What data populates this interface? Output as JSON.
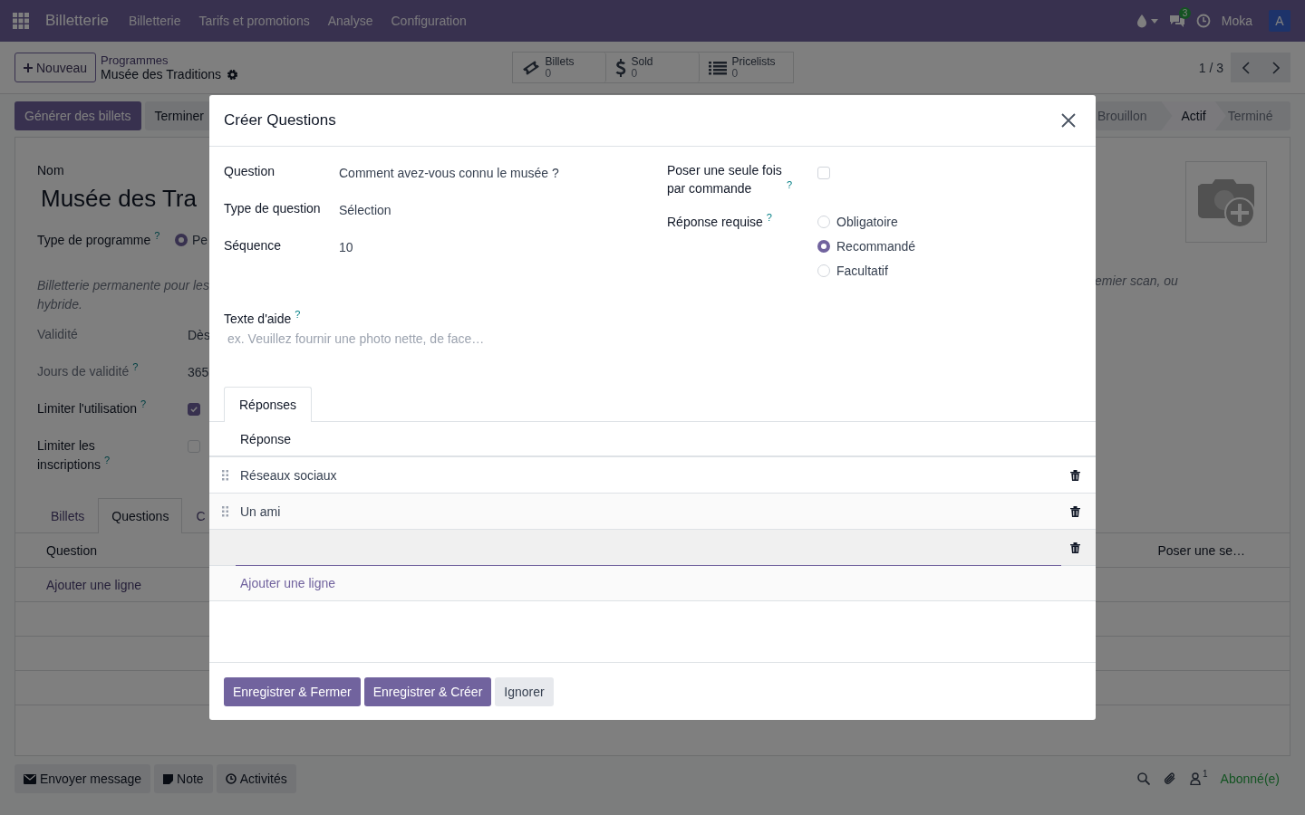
{
  "navbar": {
    "app_name": "Billetterie",
    "menu": [
      "Billetterie",
      "Tarifs et promotions",
      "Analyse",
      "Configuration"
    ],
    "chat_count": "3",
    "company": "Moka",
    "avatar": "A"
  },
  "control_panel": {
    "new_button": "Nouveau",
    "breadcrumb": "Programmes",
    "record_title": "Musée des Traditions",
    "smart_buttons": [
      {
        "kind": "ticket",
        "label": "Billets",
        "value": "0"
      },
      {
        "kind": "dollar",
        "label": "Sold",
        "value": "0"
      },
      {
        "kind": "list",
        "label": "Pricelists",
        "value": "0"
      }
    ],
    "pager": "1 / 3"
  },
  "status_bar": {
    "buttons": [
      {
        "label": "Générer des billets",
        "primary": true
      },
      {
        "label": "Terminer",
        "primary": false
      }
    ],
    "stages": [
      {
        "label": "Brouillon",
        "selected": false
      },
      {
        "label": "Actif",
        "selected": true
      },
      {
        "label": "Terminé",
        "selected": false
      }
    ]
  },
  "form": {
    "name_label": "Nom",
    "name_value": "Musée des Tra",
    "program_type": {
      "label": "Type de programme",
      "help": "?",
      "option": "Pe",
      "selected": true
    },
    "description_left": [
      "Billetterie permanente pour les",
      "hybride."
    ],
    "description_right": "emier scan, ou",
    "fields": [
      {
        "kind": "text",
        "label": "Validité",
        "value": "Dès",
        "readonly": true
      },
      {
        "kind": "text",
        "label": "Jours de validité",
        "help": "?",
        "value": "365",
        "readonly": true
      },
      {
        "kind": "checkbox",
        "label": "Limiter l'utilisation",
        "help": "?",
        "checked": true,
        "readonly": false
      },
      {
        "kind": "checkbox",
        "label": "Limiter les inscriptions",
        "help": "?",
        "checked": false,
        "readonly": false
      }
    ],
    "tabs": [
      {
        "label": "Billets",
        "selected": false
      },
      {
        "label": "Questions",
        "selected": true
      },
      {
        "label": "C",
        "selected": false
      }
    ],
    "list": {
      "columns": [
        "Question",
        "Poser une se…"
      ],
      "add_line": "Ajouter une ligne"
    }
  },
  "chatter": {
    "buttons": [
      {
        "kind": "message",
        "label": "Envoyer message"
      },
      {
        "kind": "note",
        "label": "Note"
      },
      {
        "kind": "activity",
        "label": "Activités"
      }
    ],
    "followers": "1",
    "follow_status": "Abonné(e)"
  },
  "dialog": {
    "title": "Créer Questions",
    "fields": [
      {
        "label": "Question",
        "value": "Comment avez-vous connu le musée ?"
      },
      {
        "label": "Type de question",
        "value": "Sélection"
      },
      {
        "label": "Séquence",
        "value": "10"
      }
    ],
    "once_per_order": {
      "label": "Poser une seule fois par commande",
      "help": "?",
      "checked": false
    },
    "required": {
      "label": "Réponse requise",
      "help": "?",
      "options": [
        {
          "label": "Obligatoire",
          "selected": false
        },
        {
          "label": "Recommandé",
          "selected": true
        },
        {
          "label": "Facultatif",
          "selected": false
        }
      ]
    },
    "help_text": {
      "label": "Texte d'aide",
      "help": "?",
      "placeholder": "ex. Veuillez fournir une photo nette, de face…"
    },
    "tabs": [
      {
        "label": "Réponses",
        "selected": true
      }
    ],
    "answers": {
      "column": "Réponse",
      "rows": [
        {
          "kind": "record",
          "text": "Réseaux sociaux"
        },
        {
          "kind": "record",
          "text": "Un ami"
        },
        {
          "kind": "editing"
        }
      ],
      "add_line": "Ajouter une ligne"
    },
    "buttons": [
      {
        "label": "Enregistrer & Fermer",
        "primary": true
      },
      {
        "label": "Enregistrer & Créer",
        "primary": true
      },
      {
        "label": "Ignorer",
        "primary": false
      }
    ]
  }
}
